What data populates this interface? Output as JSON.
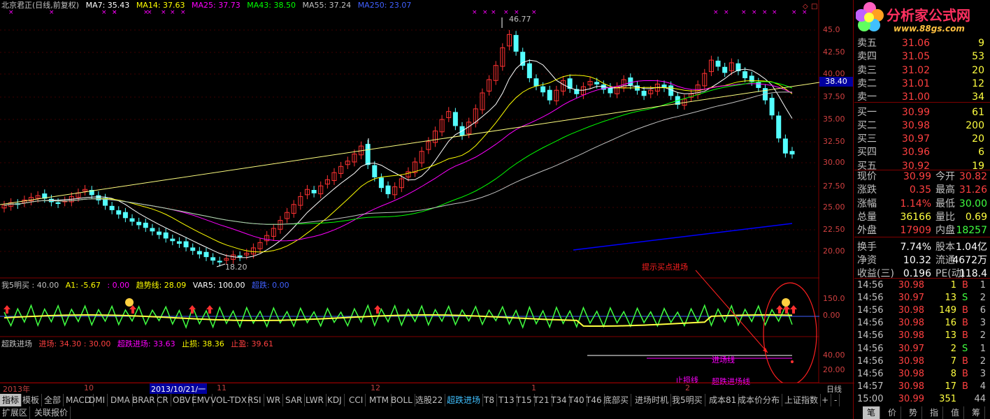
{
  "legend_main": {
    "stock": "北京君正(日线,前复权)",
    "ma7": "MA7: 35.43",
    "ma14": "MA14: 37.63",
    "ma25": "MA25: 37.73",
    "ma43": "MA43: 38.50",
    "ma55": "MA55: 37.24",
    "ma250": "MA250: 23.07"
  },
  "legend_ind1": {
    "name": "我5明买 : 40.00",
    "a1": "A1: -5.67",
    "zero": ": 0.00",
    "trend": "趋势线: 28.09",
    "var5": "VAR5: 100.00",
    "cd": "超跌: 0.00"
  },
  "legend_ind2": {
    "name": "超跌进场",
    "entry": "进场: 34.30 : 30.00",
    "cd_entry": "超跌进场: 33.63",
    "stop": "止损: 38.36",
    "profit": "止盈: 39.61"
  },
  "logo": {
    "title": "分析家公式网",
    "url": "www.88gs.com"
  },
  "annotations": {
    "high": "46.77",
    "low": "18.20",
    "hint": "提示买点进场",
    "price_tag": "38.40",
    "jc": "进场线",
    "zs": "止损线",
    "cdjc": "超跌进场线"
  },
  "price_axis": [
    "45.0",
    "42.50",
    "40.00",
    "37.50",
    "35.00",
    "32.50",
    "30.00",
    "27.50",
    "25.00",
    "22.50",
    "20.00"
  ],
  "ind1_axis": [
    "150.0",
    "0.00"
  ],
  "ind2_axis": [
    "40.00",
    "20.00"
  ],
  "date_axis": {
    "year": "2013年",
    "m10": "10",
    "cursor": "2013/10/21/一",
    "m11": "11",
    "m12": "12",
    "m1": "1",
    "m2": "2",
    "period": "日线"
  },
  "order_book": [
    {
      "label": "卖五",
      "price": "31.06",
      "vol": "9"
    },
    {
      "label": "卖四",
      "price": "31.05",
      "vol": "53"
    },
    {
      "label": "卖三",
      "price": "31.02",
      "vol": "20"
    },
    {
      "label": "卖二",
      "price": "31.01",
      "vol": "12"
    },
    {
      "label": "卖一",
      "price": "31.00",
      "vol": "34"
    },
    {
      "label": "买一",
      "price": "30.99",
      "vol": "61"
    },
    {
      "label": "买二",
      "price": "30.98",
      "vol": "200"
    },
    {
      "label": "买三",
      "price": "30.97",
      "vol": "20"
    },
    {
      "label": "买四",
      "price": "30.96",
      "vol": "6"
    },
    {
      "label": "买五",
      "price": "30.92",
      "vol": "19"
    }
  ],
  "quote": [
    {
      "l1": "现价",
      "v1": "30.99",
      "l2": "今开",
      "v2": "30.82"
    },
    {
      "l1": "涨跌",
      "v1": "0.35",
      "l2": "最高",
      "v2": "31.26"
    },
    {
      "l1": "涨幅",
      "v1": "1.14%",
      "l2": "最低",
      "v2": "30.00"
    },
    {
      "l1": "总量",
      "v1": "36166",
      "l2": "量比",
      "v2": "0.69"
    },
    {
      "l1": "外盘",
      "v1": "17909",
      "l2": "内盘",
      "v2": "18257"
    },
    {
      "l1": "换手",
      "v1": "7.74%",
      "l2": "股本",
      "v2": "1.04亿"
    },
    {
      "l1": "净资",
      "v1": "10.32",
      "l2": "流通",
      "v2": "4672万"
    },
    {
      "l1": "收益(三)",
      "v1": "0.196",
      "l2": "PE(动)",
      "v2": "118.4"
    }
  ],
  "ticks": [
    {
      "t": "14:56",
      "p": "30.98",
      "v": "1",
      "s": "B",
      "n": "1"
    },
    {
      "t": "14:56",
      "p": "30.97",
      "v": "13",
      "s": "S",
      "n": "2"
    },
    {
      "t": "14:56",
      "p": "30.98",
      "v": "149",
      "s": "B",
      "n": "6"
    },
    {
      "t": "14:56",
      "p": "30.98",
      "v": "16",
      "s": "B",
      "n": "3"
    },
    {
      "t": "14:56",
      "p": "30.98",
      "v": "13",
      "s": "B",
      "n": "2"
    },
    {
      "t": "14:56",
      "p": "30.97",
      "v": "2",
      "s": "S",
      "n": "1"
    },
    {
      "t": "14:56",
      "p": "30.98",
      "v": "7",
      "s": "B",
      "n": "2"
    },
    {
      "t": "14:56",
      "p": "30.98",
      "v": "8",
      "s": "B",
      "n": "3"
    },
    {
      "t": "14:57",
      "p": "30.98",
      "v": "17",
      "s": "B",
      "n": "4"
    },
    {
      "t": "15:00",
      "p": "30.99",
      "v": "351",
      "s": "",
      "n": "44"
    }
  ],
  "tabs": [
    "指标",
    "模板",
    "全部",
    "MACD",
    "DMI",
    "DMA",
    "BRAR",
    "CR",
    "OBV",
    "EMV",
    "VOL-TDX",
    "RSI",
    "WR",
    "SAR",
    "LWR",
    "KDJ",
    "CCI",
    "MTM",
    "BOLL",
    "选股22",
    "超跌进场",
    "T8",
    "T13",
    "T15",
    "T21",
    "T34",
    "T40",
    "T46",
    "底部买",
    "进场时机",
    "我5明买",
    "成本81",
    "成本价分布",
    "上证指数"
  ],
  "tab_nav": [
    "+",
    "-"
  ],
  "bottom_tabs": [
    "扩展区",
    "关联报价"
  ],
  "bottom_right": [
    "笔",
    "价",
    "势",
    "指",
    "值",
    "筹"
  ],
  "colors": {
    "up": "#ff3232",
    "down": "#54ffff",
    "ma7": "#ffffff",
    "ma14": "#ffff00",
    "ma25": "#ff00ff",
    "ma43": "#00ff00",
    "ma55": "#c0c0c0",
    "ma250": "#0000ff"
  }
}
